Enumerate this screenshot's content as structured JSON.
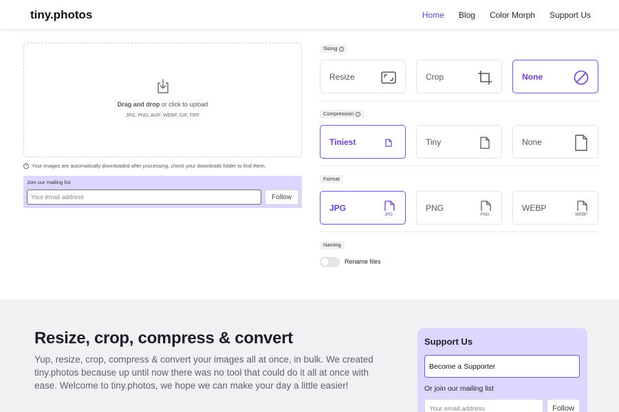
{
  "header": {
    "logo": "tiny.photos",
    "nav": [
      {
        "label": "Home",
        "active": true
      },
      {
        "label": "Blog"
      },
      {
        "label": "Color Morph"
      },
      {
        "label": "Support Us"
      }
    ]
  },
  "upload": {
    "drag_bold": "Drag and drop",
    "drag_rest": " or click to upload",
    "formats": "JPG, PNG, AVIF, WEBP, GIF, TIFF",
    "note": "Your images are automatically downloaded after processing, check your downloads folder to find them."
  },
  "mailing": {
    "label": "Join our mailing list",
    "placeholder": "Your email address",
    "button": "Follow"
  },
  "settings": {
    "sizing": {
      "label": "Sizing",
      "options": [
        {
          "label": "Resize",
          "icon": "resize-icon"
        },
        {
          "label": "Crop",
          "icon": "crop-icon"
        },
        {
          "label": "None",
          "icon": "none-icon",
          "selected": true
        }
      ]
    },
    "compression": {
      "label": "Compression",
      "options": [
        {
          "label": "Tiniest",
          "icon": "file-small-icon",
          "selected": true
        },
        {
          "label": "Tiny",
          "icon": "file-medium-icon"
        },
        {
          "label": "None",
          "icon": "file-large-icon"
        }
      ]
    },
    "format": {
      "label": "Format",
      "options": [
        {
          "label": "JPG",
          "badge": "JPG",
          "icon": "file-jpg-icon",
          "selected": true
        },
        {
          "label": "PNG",
          "badge": "PNG",
          "icon": "file-png-icon"
        },
        {
          "label": "WEBP",
          "badge": "WEBP",
          "icon": "file-webp-icon"
        }
      ]
    },
    "naming": {
      "label": "Naming",
      "toggle_label": "Rename files",
      "enabled": false
    }
  },
  "hero": {
    "title": "Resize, crop, compress & convert",
    "text": "Yup, resize, crop, compress & convert your images all at once, in bulk. We created tiny.photos because up until now there was no tool that could do it all at once with ease. Welcome to tiny.photos, we hope we can make your day a little easier!"
  },
  "support": {
    "title": "Support Us",
    "button": "Become a Supporter",
    "sub": "Or join our mailing list",
    "placeholder": "Your email address",
    "follow": "Follow"
  },
  "colors": {
    "accent": "#6b3fc4",
    "panel": "#ddd6ff",
    "bottom_bg": "#f1f1f4"
  }
}
